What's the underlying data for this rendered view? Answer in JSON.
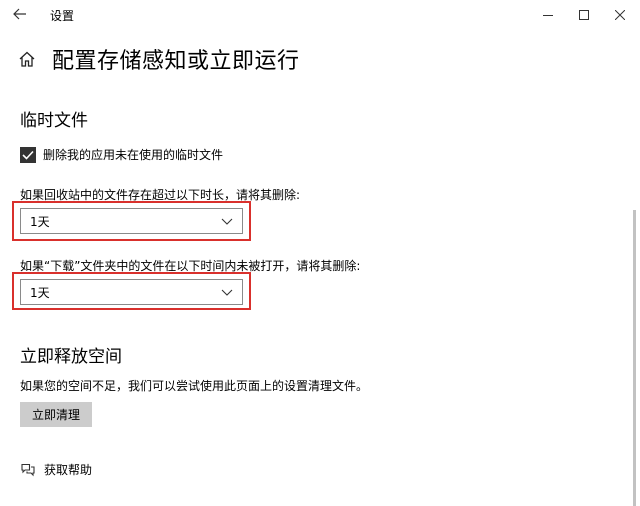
{
  "window": {
    "app_title": "设置"
  },
  "header": {
    "title": "配置存储感知或立即运行"
  },
  "temp_files": {
    "section_title": "临时文件",
    "checkbox_label": "删除我的应用未在使用的临时文件",
    "checkbox_checked": true,
    "recycle_label": "如果回收站中的文件存在超过以下时长，请将其删除:",
    "recycle_value": "1天",
    "downloads_label": "如果“下载”文件夹中的文件在以下时间内未被打开，请将其删除:",
    "downloads_value": "1天"
  },
  "free_space": {
    "section_title": "立即释放空间",
    "description": "如果您的空间不足，我们可以尝试使用此页面上的设置清理文件。",
    "button_label": "立即清理"
  },
  "help": {
    "link_label": "获取帮助"
  },
  "colors": {
    "highlight": "#d9302c",
    "button_bg": "#cccccc"
  }
}
